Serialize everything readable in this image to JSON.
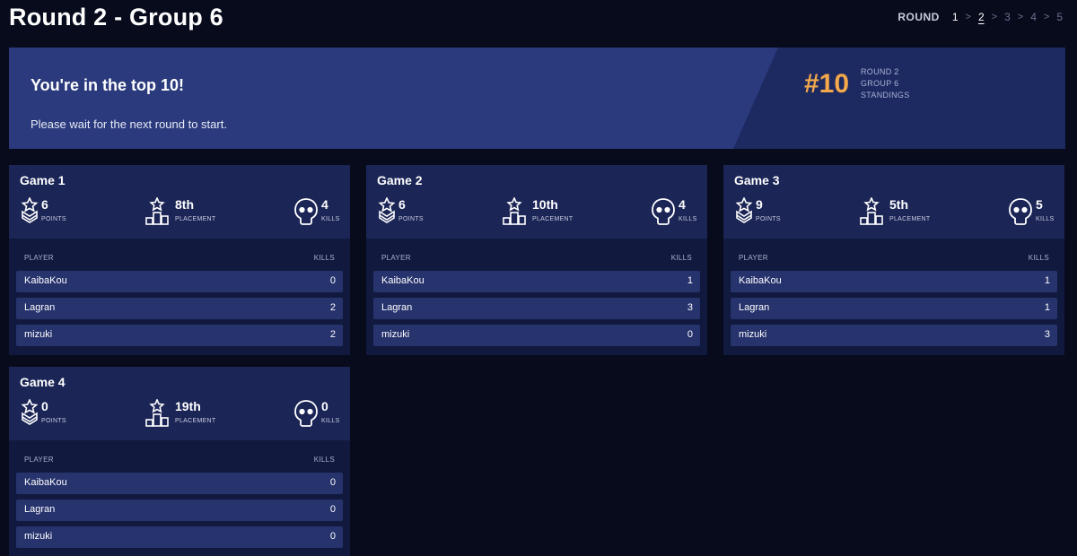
{
  "header": {
    "title": "Round 2 - Group 6",
    "round_label": "ROUND",
    "rounds": [
      "1",
      "2",
      "3",
      "4",
      "5"
    ]
  },
  "banner": {
    "headline": "You're in the top 10!",
    "message": "Please wait for the next round to start.",
    "rank": "#10",
    "meta_round": "ROUND 2",
    "meta_group": "GROUP 6",
    "meta_standings": "STANDINGS"
  },
  "labels": {
    "points": "POINTS",
    "placement": "PLACEMENT",
    "kills": "KILLS",
    "player_col": "PLAYER",
    "kills_col": "KILLS"
  },
  "colors": {
    "background": "#070b1c",
    "banner": "#2a3a7c",
    "rank_accent": "#f3a84a",
    "card": "#111a3e",
    "row": "#27336d"
  },
  "games": [
    {
      "title": "Game 1",
      "points": "6",
      "placement": "8th",
      "kills": "4",
      "players": [
        {
          "name": "KaibaKou",
          "kills": "0"
        },
        {
          "name": "Lagran",
          "kills": "2"
        },
        {
          "name": "mizuki",
          "kills": "2"
        }
      ]
    },
    {
      "title": "Game 2",
      "points": "6",
      "placement": "10th",
      "kills": "4",
      "players": [
        {
          "name": "KaibaKou",
          "kills": "1"
        },
        {
          "name": "Lagran",
          "kills": "3"
        },
        {
          "name": "mizuki",
          "kills": "0"
        }
      ]
    },
    {
      "title": "Game 3",
      "points": "9",
      "placement": "5th",
      "kills": "5",
      "players": [
        {
          "name": "KaibaKou",
          "kills": "1"
        },
        {
          "name": "Lagran",
          "kills": "1"
        },
        {
          "name": "mizuki",
          "kills": "3"
        }
      ]
    },
    {
      "title": "Game 4",
      "points": "0",
      "placement": "19th",
      "kills": "0",
      "players": [
        {
          "name": "KaibaKou",
          "kills": "0"
        },
        {
          "name": "Lagran",
          "kills": "0"
        },
        {
          "name": "mizuki",
          "kills": "0"
        }
      ]
    }
  ]
}
